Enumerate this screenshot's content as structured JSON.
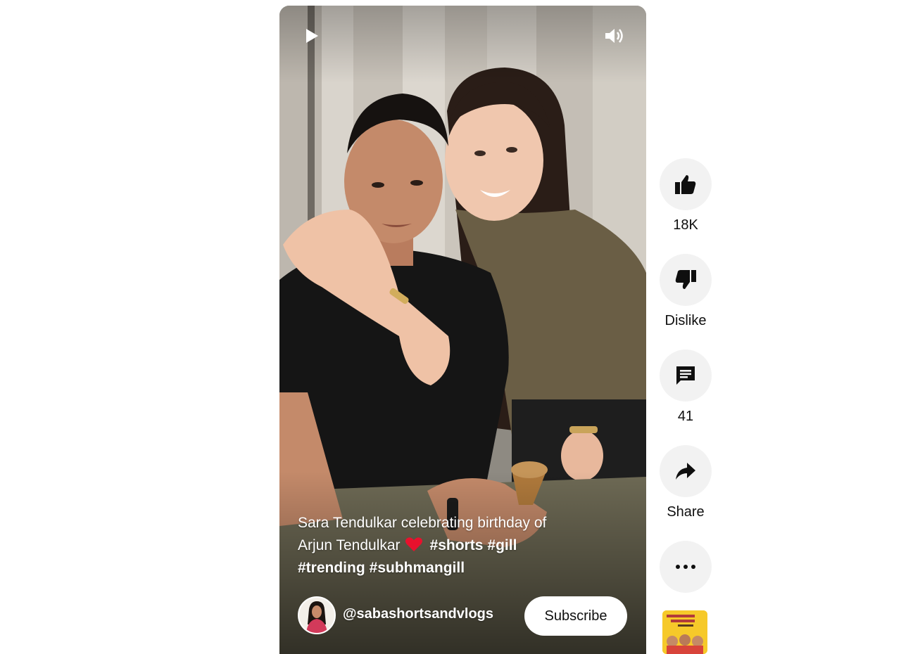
{
  "player": {
    "play_icon": "play-icon",
    "volume_icon": "volume-icon",
    "caption": {
      "line1": "Sara Tendulkar celebrating birthday of",
      "line2_text": "Arjun Tendulkar",
      "heart_icon": "red-heart-emoji",
      "line2_tags": [
        "#shorts",
        "#gill"
      ],
      "line3_tags": [
        "#trending",
        "#subhmangill"
      ]
    },
    "channel": {
      "handle": "@sabashortsandvlogs",
      "subscribe_label": "Subscribe"
    }
  },
  "actions": {
    "like": {
      "icon": "thumbs-up-icon",
      "label": "18K"
    },
    "dislike": {
      "icon": "thumbs-down-icon",
      "label": "Dislike"
    },
    "comments": {
      "icon": "comment-icon",
      "label": "41"
    },
    "share": {
      "icon": "share-icon",
      "label": "Share"
    },
    "more": {
      "icon": "more-horizontal-icon"
    }
  },
  "colors": {
    "page_bg": "#ffffff",
    "action_circle_bg": "#f2f2f2",
    "subscribe_bg": "#ffffff",
    "caption_text": "#ffffff",
    "heart": "#e8112d"
  }
}
